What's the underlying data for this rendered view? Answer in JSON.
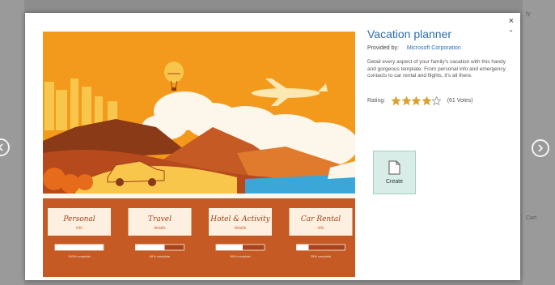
{
  "template": {
    "title": "Vacation planner",
    "provided_label": "Provided by:",
    "provider": "Microsoft Corporation",
    "description": "Detail every aspect of your family's vacation with this handy and gorgeous template. From personal info and emergency contacts to car rental and flights, it's all there.",
    "rating_label": "Rating:",
    "rating_stars": 4,
    "rating_max": 5,
    "votes": "(61 Votes)",
    "create_label": "Create"
  },
  "dialog": {
    "close": "×",
    "pin": "⌃"
  },
  "preview": {
    "cards": [
      {
        "title": "Personal",
        "sub": "info",
        "progress": 0.99,
        "progress_label": "100% complete"
      },
      {
        "title": "Travel",
        "sub": "details",
        "progress": 0.6,
        "progress_label": "60% complete"
      },
      {
        "title": "Hotel & Activity",
        "sub": "details",
        "progress": 0.55,
        "progress_label": "55% complete"
      },
      {
        "title": "Car Rental",
        "sub": "info",
        "progress": 0.25,
        "progress_label": "25% complete"
      }
    ]
  },
  "colors": {
    "accent": "#2b6cb0",
    "orange": "#f39a1d",
    "rust": "#c55a24",
    "star": "#d9a32e"
  },
  "background": {
    "bg_a": "Cart",
    "bg_b": "ty"
  }
}
